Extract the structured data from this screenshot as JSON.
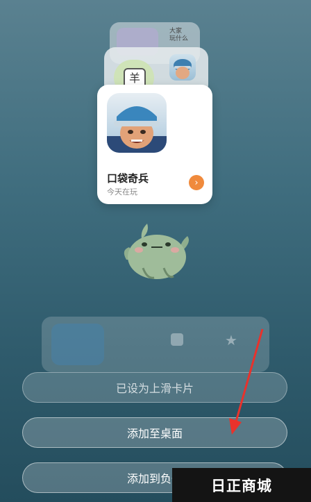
{
  "widget": {
    "game_name": "口袋奇兵",
    "game_subtitle": "今天在玩"
  },
  "back_card": {
    "label_top": "大家",
    "label_bottom": "玩什么",
    "badge_char": "羊"
  },
  "buttons": {
    "set_label": "已设为上滑卡片",
    "desktop_label": "添加至桌面",
    "minus_one_label": "添加到负一"
  },
  "watermark": {
    "text": "日正商城"
  },
  "colors": {
    "accent_orange": "#f08a3c",
    "arrow_red": "#e8322c",
    "background_teal": "#3f6d7e"
  }
}
